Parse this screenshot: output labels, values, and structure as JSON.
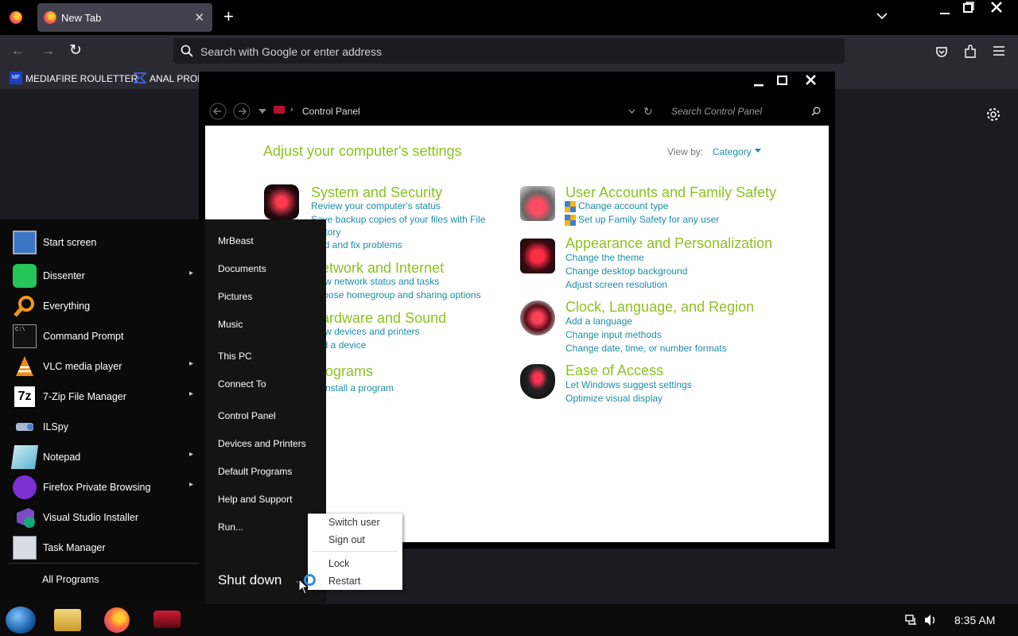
{
  "browser": {
    "tab_title": "New Tab",
    "tab_close": "✕",
    "new_tab": "+",
    "url_placeholder": "Search with Google or enter address",
    "bookmarks": [
      "MEDIAFIRE ROULETTER",
      "ANAL PROL"
    ],
    "bookmark_badge": "MF"
  },
  "control_panel": {
    "breadcrumb": "Control Panel",
    "search_placeholder": "Search Control Panel",
    "heading": "Adjust your computer's settings",
    "view_by_label": "View by:",
    "view_by_value": "Category",
    "categories": [
      {
        "title": "System and Security",
        "links": [
          "Review your computer's status",
          "Save backup copies of your files with File",
          "History",
          "Find and fix problems"
        ]
      },
      {
        "title": "Network and Internet",
        "links": [
          "View network status and tasks",
          "Choose homegroup and sharing options"
        ]
      },
      {
        "title": "Hardware and Sound",
        "links": [
          "View devices and printers",
          "Add a device"
        ]
      },
      {
        "title": "Programs",
        "links": [
          "Uninstall a program"
        ]
      },
      {
        "title": "User Accounts and Family Safety",
        "links": [
          "Change account type",
          "Set up Family Safety for any user"
        ]
      },
      {
        "title": "Appearance and Personalization",
        "links": [
          "Change the theme",
          "Change desktop background",
          "Adjust screen resolution"
        ]
      },
      {
        "title": "Clock, Language, and Region",
        "links": [
          "Add a language",
          "Change input methods",
          "Change date, time, or number formats"
        ]
      },
      {
        "title": "Ease of Access",
        "links": [
          "Let Windows suggest settings",
          "Optimize visual display"
        ]
      }
    ]
  },
  "start_menu": {
    "programs": [
      {
        "label": "Start screen",
        "arrow": false
      },
      {
        "label": "Dissenter",
        "arrow": true
      },
      {
        "label": "Everything",
        "arrow": false
      },
      {
        "label": "Command Prompt",
        "arrow": false
      },
      {
        "label": "VLC media player",
        "arrow": true
      },
      {
        "label": "7-Zip File Manager",
        "arrow": true
      },
      {
        "label": "ILSpy",
        "arrow": false
      },
      {
        "label": "Notepad",
        "arrow": true
      },
      {
        "label": "Firefox Private Browsing",
        "arrow": true
      },
      {
        "label": "Visual Studio Installer",
        "arrow": false
      },
      {
        "label": "Task Manager",
        "arrow": false
      }
    ],
    "all_programs": "All Programs",
    "places": [
      "MrBeast",
      "Documents",
      "Pictures",
      "Music",
      "This PC",
      "Connect To",
      "Control Panel",
      "Devices and Printers",
      "Default Programs",
      "Help and Support",
      "Run..."
    ],
    "shutdown_label": "Shut down",
    "shutdown_arrow": "→",
    "power_menu": [
      "Switch user",
      "Sign out",
      "Lock",
      "Restart"
    ]
  },
  "taskbar": {
    "clock": "8:35 AM"
  },
  "icons": {
    "seven_zip": "7z",
    "cmd": "C:\\"
  }
}
